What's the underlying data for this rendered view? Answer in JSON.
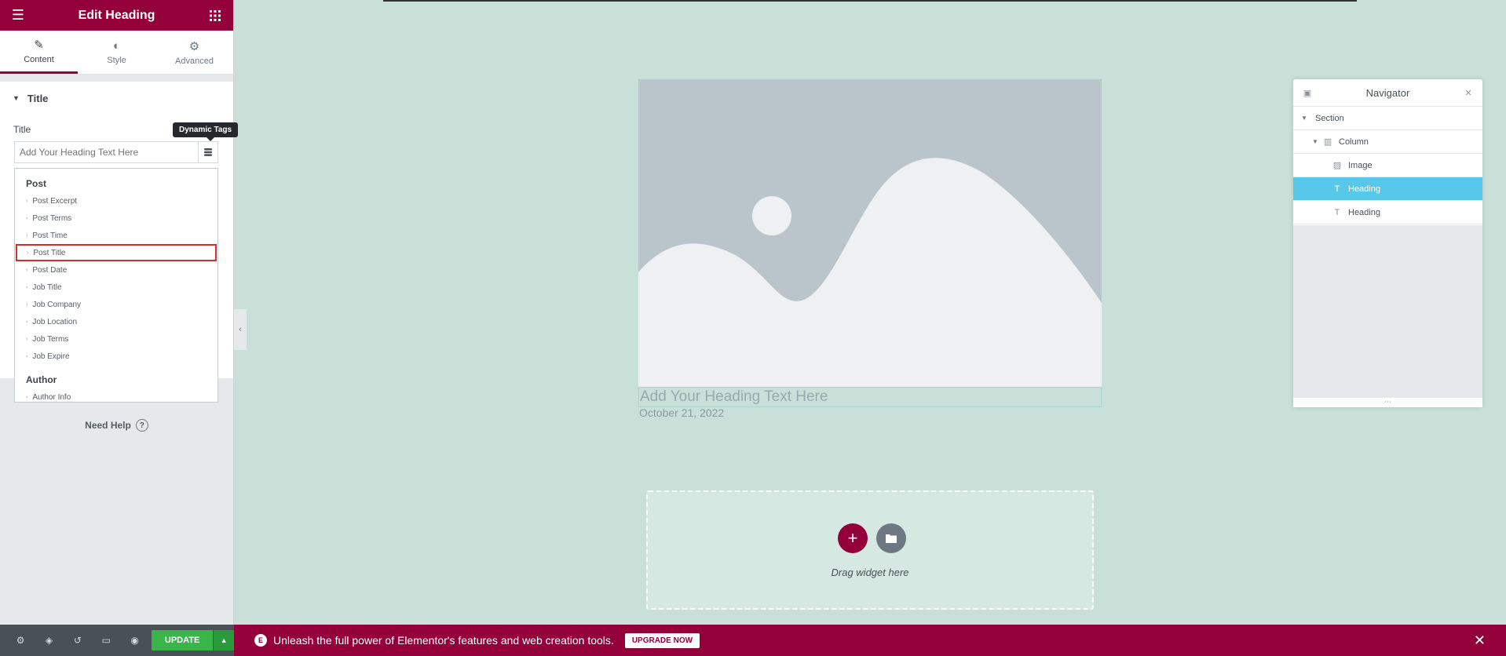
{
  "panel": {
    "title": "Edit Heading",
    "tabs": [
      {
        "label": "Content",
        "icon": "pencil-icon"
      },
      {
        "label": "Style",
        "icon": "half-circle-icon"
      },
      {
        "label": "Advanced",
        "icon": "gear-icon"
      }
    ],
    "section_title": "Title",
    "control_label": "Title",
    "input_placeholder": "Add Your Heading Text Here",
    "tooltip": "Dynamic Tags",
    "dropdown": {
      "groups": [
        {
          "label": "Post",
          "items": [
            "Post Excerpt",
            "Post Terms",
            "Post Time",
            "Post Title",
            "Post Date",
            "Job Title",
            "Job Company",
            "Job Location",
            "Job Terms",
            "Job Expire"
          ]
        },
        {
          "label": "Author",
          "items": [
            "Author Info"
          ]
        }
      ],
      "highlighted_item": "Post Title"
    },
    "need_help": "Need Help",
    "update_label": "UPDATE"
  },
  "canvas": {
    "heading": "Add Your Heading Text Here",
    "date": "October 21, 2022",
    "drag_label": "Drag widget here"
  },
  "navigator": {
    "title": "Navigator",
    "rows": [
      {
        "label": "Section",
        "icon": "none"
      },
      {
        "label": "Column",
        "icon": "column-icon"
      },
      {
        "label": "Image",
        "icon": "image-icon"
      },
      {
        "label": "Heading",
        "icon": "heading-icon",
        "selected": true
      },
      {
        "label": "Heading",
        "icon": "heading-icon"
      }
    ]
  },
  "promo": {
    "text": "Unleash the full power of Elementor's features and web creation tools.",
    "button": "UPGRADE NOW"
  },
  "colors": {
    "brand": "#93003a",
    "canvas_bg": "#c8e0d8",
    "update_green": "#39b54a",
    "navigator_selected": "#58c8ea"
  }
}
